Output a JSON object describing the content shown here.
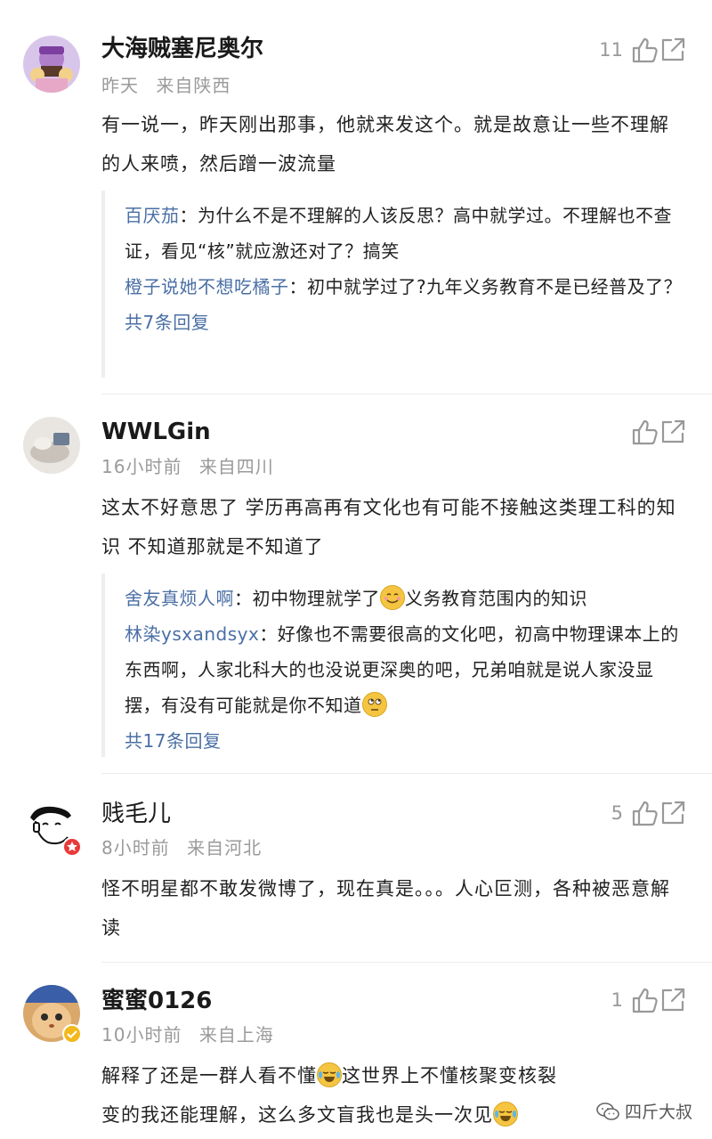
{
  "comments": [
    {
      "username": "大海贼塞尼奥尔",
      "time": "昨天",
      "location": "来自陕西",
      "likes": "11",
      "text": "有一说一，昨天刚出那事，他就来发这个。就是故意让一些不理解的人来喷，然后蹭一波流量",
      "replies": [
        {
          "user": "百厌茄",
          "text": "：为什么不是不理解的人该反思？高中就学过。不理解也不查证，看见“核”就应激还对了？搞笑"
        },
        {
          "user": "橙子说她不想吃橘子",
          "text": "：初中就学过了?九年义务教育不是已经普及了？"
        }
      ],
      "more": "共7条回复"
    },
    {
      "username": "WWLGin",
      "time": "16小时前",
      "location": "来自四川",
      "likes": "",
      "text": "这太不好意思了 学历再高再有文化也有可能不接触这类理工科的知识 不知道那就是不知道了",
      "replies": [
        {
          "user": "舍友真烦人啊",
          "text": "：初中物理就学了",
          "emoji": "smile",
          "text2": "义务教育范围内的知识"
        },
        {
          "user": "林染ysxandsyx",
          "text": "：好像也不需要很高的文化吧，初高中物理课本上的东西啊，人家北科大的也没说更深奥的吧，兄弟咱就是说人家没显摆，有没有可能就是你不知道",
          "emoji": "rolleyes",
          "text2": ""
        }
      ],
      "more": "共17条回复"
    },
    {
      "username": "贱毛儿",
      "time": "8小时前",
      "location": "来自河北",
      "likes": "5",
      "text": "怪不明星都不敢发微博了，现在真是。。。人心叵测，各种被恶意解读"
    },
    {
      "username": "蜜蜜0126",
      "time": "10小时前",
      "location": "来自上海",
      "likes": "1",
      "text_a": "解释了还是一群人看不懂",
      "text_b": "这世界上不懂核聚变核裂变的我还能理解，这么多文盲我也是头一次见"
    }
  ],
  "watermark": "四斤大叔",
  "icons": {
    "like": "thumbs-up-icon",
    "share": "share-icon",
    "verified": "verified-badge-icon"
  },
  "colors": {
    "link": "#4a6fa5",
    "meta": "#9a9a9a",
    "badge_red": "#e83a3a",
    "badge_gold": "#f3b81c"
  }
}
